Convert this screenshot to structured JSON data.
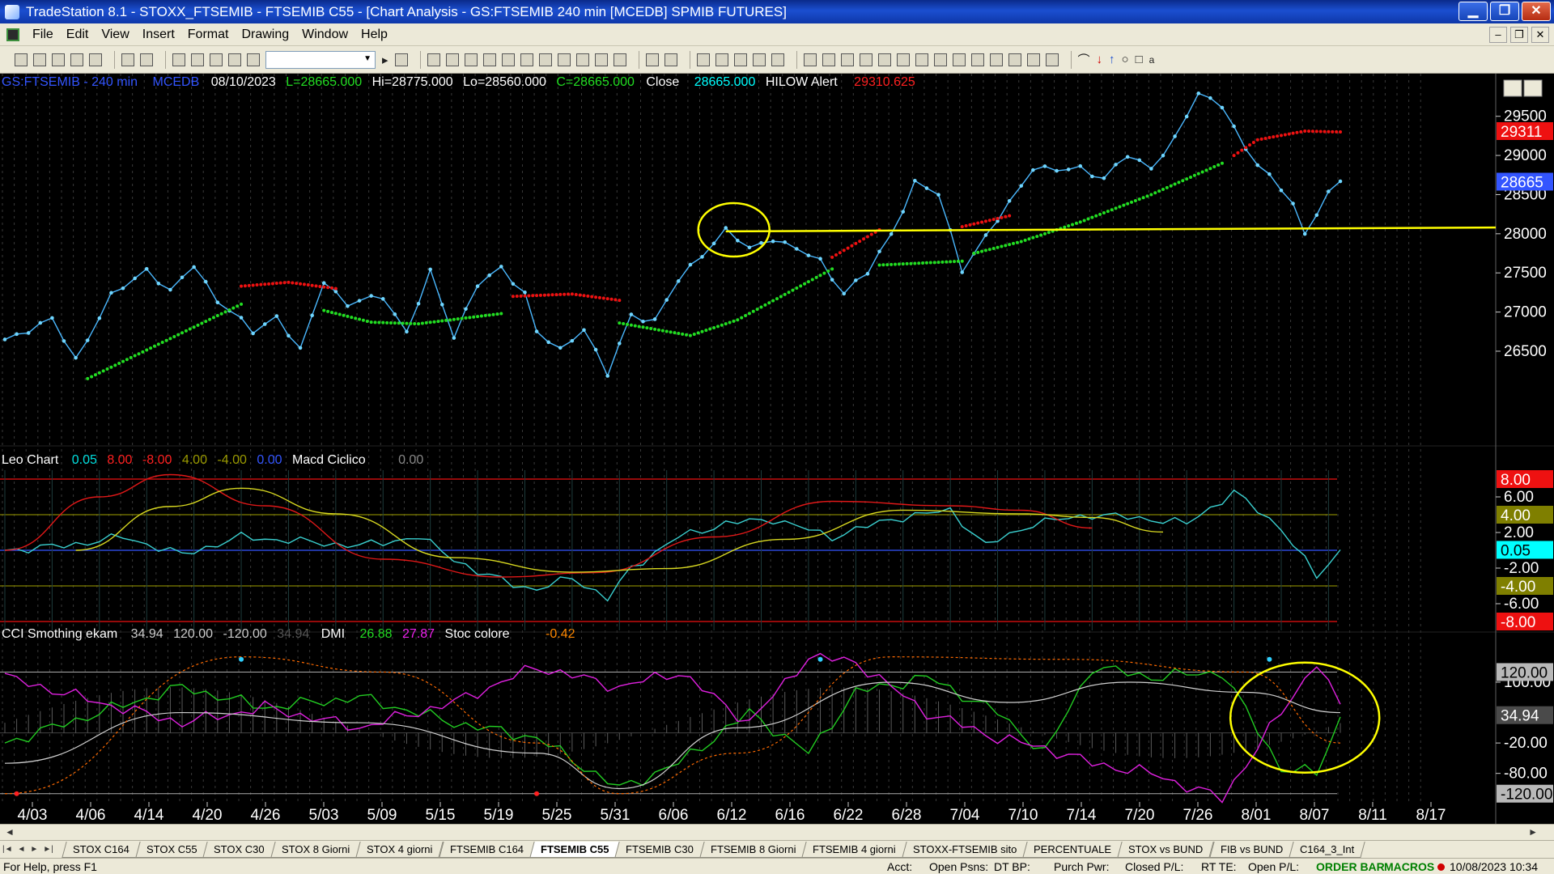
{
  "window": {
    "title": "TradeStation 8.1 - STOXX_FTSEMIB - FTSEMIB C55 - [Chart Analysis - GS:FTSEMIB  240 min  [MCEDB] SPMIB FUTURES]",
    "minimize": "▁",
    "maximize": "❐",
    "close": "✕"
  },
  "menu": [
    "File",
    "Edit",
    "View",
    "Insert",
    "Format",
    "Drawing",
    "Window",
    "Help"
  ],
  "mdi_buttons": [
    "–",
    "❐",
    "✕"
  ],
  "colors": {
    "background": "#000000",
    "price": "#4ab8ff",
    "hilow_up": "#22dd22",
    "hilow_down": "#ee1111",
    "support": "#ffff00",
    "grid": "#4a4a4a",
    "label_red": "#ff0000",
    "label_cyan": "#00ffff",
    "label_olive": "#7f7f00",
    "label_blue": "#3355ff",
    "axis_text": "#ffffff"
  },
  "header": {
    "symbol": "GS:FTSEMIB - 240 min",
    "feed": "MCEDB",
    "date": "08/10/2023",
    "low": "L=28665.000",
    "high": "Hi=28775.000",
    "lo": "Lo=28560.000",
    "close_field": "C=28665.000",
    "close_label": "Close",
    "close_value": "28665.000",
    "study": "HILOW Alert",
    "study_value": "29310.625"
  },
  "leo_header": {
    "name": "Leo Chart",
    "v1": "0.05",
    "v2": "8.00",
    "v3": "-8.00",
    "v4": "4.00",
    "v5": "-4.00",
    "v6": "0.00",
    "name2": "Macd Ciclico",
    "v7": "0.00"
  },
  "cci_header": {
    "name": "CCI Smothing ekam",
    "v1": "34.94",
    "v2": "120.00",
    "v3": "-120.00",
    "v4": "34.94",
    "dmi": "DMI",
    "dmi1": "26.88",
    "dmi2": "27.87",
    "stoc": "Stoc colore",
    "stoc1": "-0.42"
  },
  "chart_data": [
    {
      "type": "line",
      "title": "GS:FTSEMIB - 240 min",
      "x": [
        "4/03",
        "4/06",
        "4/14",
        "4/20",
        "4/26",
        "5/03",
        "5/09",
        "5/15",
        "5/19",
        "5/25",
        "5/31",
        "6/06",
        "6/12",
        "6/16",
        "6/22",
        "6/28",
        "7/04",
        "7/10",
        "7/14",
        "7/20",
        "7/26",
        "8/01",
        "8/07",
        "8/11",
        "8/17"
      ],
      "ylim": [
        26200,
        29900
      ],
      "yticks": [
        "29500",
        "29000",
        "28500",
        "28000",
        "27500",
        "27000",
        "26500"
      ],
      "axis_labels": [
        {
          "text": "29311",
          "value": 29311,
          "kind": "hilow"
        },
        {
          "text": "28665",
          "value": 28665,
          "kind": "last"
        }
      ],
      "price_keypoints": [
        [
          0,
          26650
        ],
        [
          4,
          26900
        ],
        [
          6,
          26400
        ],
        [
          9,
          27200
        ],
        [
          12,
          27550
        ],
        [
          14,
          27250
        ],
        [
          16,
          27600
        ],
        [
          18,
          27150
        ],
        [
          21,
          26750
        ],
        [
          23,
          26950
        ],
        [
          25,
          26500
        ],
        [
          27,
          27400
        ],
        [
          29,
          27100
        ],
        [
          32,
          27200
        ],
        [
          34,
          26750
        ],
        [
          36,
          27500
        ],
        [
          38,
          26700
        ],
        [
          40,
          27350
        ],
        [
          42,
          27550
        ],
        [
          44,
          27250
        ],
        [
          45,
          26750
        ],
        [
          47,
          26500
        ],
        [
          49,
          26800
        ],
        [
          51,
          26200
        ],
        [
          53,
          26950
        ],
        [
          55,
          26900
        ],
        [
          57,
          27400
        ],
        [
          60,
          27900
        ],
        [
          61,
          28050
        ],
        [
          63,
          27800
        ],
        [
          65,
          27950
        ],
        [
          67,
          27800
        ],
        [
          69,
          27650
        ],
        [
          71,
          27250
        ],
        [
          73,
          27500
        ],
        [
          75,
          28000
        ],
        [
          77,
          28650
        ],
        [
          79,
          28500
        ],
        [
          81,
          27550
        ],
        [
          83,
          27950
        ],
        [
          85,
          28400
        ],
        [
          87,
          28850
        ],
        [
          89,
          28800
        ],
        [
          91,
          28850
        ],
        [
          93,
          28700
        ],
        [
          95,
          29000
        ],
        [
          97,
          28850
        ],
        [
          99,
          29200
        ],
        [
          101,
          29800
        ],
        [
          103,
          29650
        ],
        [
          105,
          29050
        ],
        [
          107,
          28750
        ],
        [
          109,
          28400
        ],
        [
          110,
          27950
        ],
        [
          112,
          28550
        ],
        [
          113,
          28665
        ]
      ],
      "hilow_up": [
        [
          7,
          26150
        ],
        [
          20,
          27100
        ],
        [
          28,
          26950
        ],
        [
          35,
          26850
        ],
        [
          43,
          27000
        ],
        [
          52,
          26850
        ],
        [
          58,
          26700
        ],
        [
          62,
          26900
        ],
        [
          70,
          27550
        ],
        [
          74,
          27600
        ],
        [
          81,
          27650
        ],
        [
          86,
          27900
        ],
        [
          91,
          28150
        ],
        [
          97,
          28500
        ],
        [
          103,
          28900
        ]
      ],
      "hilow_down": [
        [
          20,
          27350
        ],
        [
          28,
          27300
        ],
        [
          43,
          27200
        ],
        [
          52,
          27150
        ],
        [
          70,
          27700
        ],
        [
          74,
          28050
        ],
        [
          81,
          28100
        ],
        [
          86,
          28250
        ],
        [
          103,
          28900
        ],
        [
          106,
          29200
        ],
        [
          110,
          29311
        ]
      ],
      "support": {
        "from": [
          61,
          28030
        ],
        "to": [
          120,
          28080
        ]
      },
      "annotations": [
        {
          "type": "ellipse",
          "at": [
            61,
            28050
          ]
        }
      ]
    },
    {
      "type": "line",
      "title": "Leo Chart",
      "ylim": [
        -9,
        9
      ],
      "yticks": [
        "6.00",
        "2.00",
        "-2.00",
        "-6.00"
      ],
      "axis_labels": [
        {
          "text": "8.00",
          "value": 8,
          "kind": "upper"
        },
        {
          "text": "4.00",
          "value": 4,
          "kind": "mid_upper"
        },
        {
          "text": "0.05",
          "value": 0.05,
          "kind": "current"
        },
        {
          "text": "-4.00",
          "value": -4,
          "kind": "mid_lower"
        },
        {
          "text": "-8.00",
          "value": -8,
          "kind": "lower"
        }
      ],
      "series": [
        {
          "name": "Leo Chart",
          "values": [
            [
              0,
              0
            ],
            [
              5,
              0.5
            ],
            [
              10,
              1.5
            ],
            [
              15,
              -0.5
            ],
            [
              20,
              1.5
            ],
            [
              25,
              1.0
            ],
            [
              30,
              0.5
            ],
            [
              35,
              1.5
            ],
            [
              40,
              -2.5
            ],
            [
              45,
              -4.5
            ],
            [
              48,
              -3.0
            ],
            [
              51,
              -5.5
            ],
            [
              53,
              -2.0
            ],
            [
              57,
              1.5
            ],
            [
              61,
              3.0
            ],
            [
              65,
              3.5
            ],
            [
              70,
              1.5
            ],
            [
              75,
              3.5
            ],
            [
              80,
              4.5
            ],
            [
              83,
              0.5
            ],
            [
              87,
              3.0
            ],
            [
              92,
              4.0
            ],
            [
              97,
              3.5
            ],
            [
              100,
              3.0
            ],
            [
              104,
              6.5
            ],
            [
              108,
              2.5
            ],
            [
              111,
              -3.0
            ],
            [
              113,
              0
            ]
          ]
        },
        {
          "name": "Macd Ciclico",
          "values": [
            [
              0,
              0
            ],
            [
              8,
              6
            ],
            [
              14,
              8.5
            ],
            [
              22,
              5
            ],
            [
              32,
              -1
            ],
            [
              42,
              -3.0
            ],
            [
              50,
              -2.5
            ],
            [
              60,
              1.5
            ],
            [
              70,
              5.5
            ],
            [
              80,
              5.0
            ],
            [
              86,
              4.5
            ],
            [
              92,
              2.5
            ]
          ]
        }
      ]
    },
    {
      "type": "line",
      "title": "CCI Smothing ekam",
      "ylim": [
        -130,
        175
      ],
      "yticks": [
        "100.00",
        "-20.00",
        "-80.00"
      ],
      "axis_labels": [
        {
          "text": "120.00",
          "value": 120,
          "kind": "upper"
        },
        {
          "text": "34.94",
          "value": 34.94,
          "kind": "current"
        },
        {
          "text": "-120.00",
          "value": -120,
          "kind": "lower"
        }
      ],
      "series": [
        {
          "name": "DMI",
          "values": [
            [
              0,
              -20
            ],
            [
              8,
              40
            ],
            [
              15,
              90
            ],
            [
              22,
              50
            ],
            [
              30,
              70
            ],
            [
              38,
              20
            ],
            [
              45,
              -10
            ],
            [
              52,
              -110
            ],
            [
              57,
              -60
            ],
            [
              63,
              40
            ],
            [
              68,
              -40
            ],
            [
              72,
              80
            ],
            [
              78,
              110
            ],
            [
              84,
              40
            ],
            [
              88,
              -40
            ],
            [
              92,
              130
            ],
            [
              97,
              110
            ],
            [
              103,
              120
            ],
            [
              108,
              -70
            ],
            [
              111,
              -80
            ],
            [
              113,
              30
            ]
          ]
        },
        {
          "name": "Stoc colore",
          "values": [
            [
              0,
              110
            ],
            [
              8,
              60
            ],
            [
              15,
              20
            ],
            [
              22,
              50
            ],
            [
              30,
              10
            ],
            [
              38,
              60
            ],
            [
              45,
              130
            ],
            [
              52,
              90
            ],
            [
              57,
              120
            ],
            [
              63,
              20
            ],
            [
              68,
              150
            ],
            [
              72,
              140
            ],
            [
              78,
              40
            ],
            [
              84,
              -10
            ],
            [
              88,
              -30
            ],
            [
              92,
              -60
            ],
            [
              97,
              -80
            ],
            [
              103,
              -130
            ],
            [
              108,
              40
            ],
            [
              111,
              140
            ],
            [
              113,
              50
            ]
          ]
        }
      ]
    }
  ],
  "hscroll": {
    "left": "◄",
    "right": "►"
  },
  "tab_nav": [
    "|◄",
    "◄",
    "►",
    "►|"
  ],
  "tabs": [
    "STOX C164",
    "STOX C55",
    "STOX  C30",
    "STOX  8 Giorni",
    "STOX 4 giorni",
    "FTSEMIB C164",
    "FTSEMIB C55",
    "FTSEMIB C30",
    "FTSEMIB  8 Giorni",
    "FTSEMIB  4 giorni",
    "STOXX-FTSEMIB sito",
    "PERCENTUALE",
    "STOX vs BUND",
    "FIB vs BUND",
    "C164_3_Int"
  ],
  "active_tab": 6,
  "status": {
    "help": "For Help, press F1",
    "acct": "Acct:",
    "open_psns": "Open Psns:",
    "dt_bp": "DT BP:",
    "purch_pwr": "Purch Pwr:",
    "closed_pl": "Closed P/L:",
    "rt_te": "RT TE:",
    "open_pl": "Open P/L:",
    "order_bar": "ORDER BAR",
    "macros": "MACROS",
    "datetime": "10/08/2023 10:34"
  }
}
